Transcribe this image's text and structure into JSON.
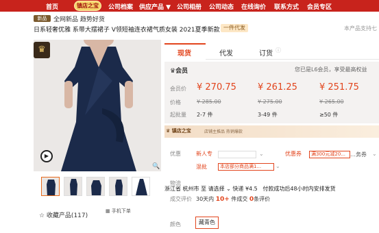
{
  "nav": {
    "items": [
      "首页",
      "公司档案",
      "供应产品 ▼",
      "公司相册",
      "公司动态",
      "在线询价",
      "联系方式",
      "会员专区"
    ],
    "badge": "镇店之宝"
  },
  "header": {
    "new_tag": "新品",
    "slogan": "全网新品 趋势好货",
    "title": "日系轻奢优雅 系带大摆裙子 V领短袖连衣裙气质女装 2021夏季新款",
    "agent_badge": "一件代发",
    "support": "本产品支持七"
  },
  "gallery": {
    "thumb_count": 5,
    "favorite": "☆ 收藏产品(117)",
    "mobile": "手机下单"
  },
  "tabs": {
    "items": [
      "现货",
      "代发",
      "订货"
    ],
    "active": 0
  },
  "price": {
    "member_label": "会员",
    "member_note": "您已是L6会员，享受最高权益",
    "row_member": "会员价",
    "row_price": "价格",
    "row_qty": "起批量",
    "member_prices": [
      "¥ 270.75",
      "¥ 261.25",
      "¥ 251.75"
    ],
    "old_prices": [
      "¥ 285.00",
      "¥ 275.00",
      "¥ 265.00"
    ],
    "quantities": [
      "2-7 件",
      "3-49 件",
      "≥50 件"
    ]
  },
  "shop": {
    "logo": "镇店之宝",
    "text": "店铺主推品  热销爆款"
  },
  "promo": {
    "label": "优惠",
    "new_user": "新人专",
    "coupon_label": "优惠券",
    "coupon_box": "满300元减20...",
    "coupon_suffix": "…务券",
    "mix_label": "混批",
    "mix_box": "本店部分商品满1..."
  },
  "logistics": {
    "label": "物流",
    "from": "浙江省 杭州市 至 请选择 ⌄ 快递 ¥4.5",
    "promise": "付款成功后48小时内安排发货"
  },
  "sales": {
    "label": "成交评价",
    "text_a": "30天内",
    "hot": "10+",
    "text_b": "件成交",
    "reviews_zero": "0",
    "reviews": "条评价"
  },
  "color": {
    "label": "颜色",
    "selected": "藏青色"
  }
}
